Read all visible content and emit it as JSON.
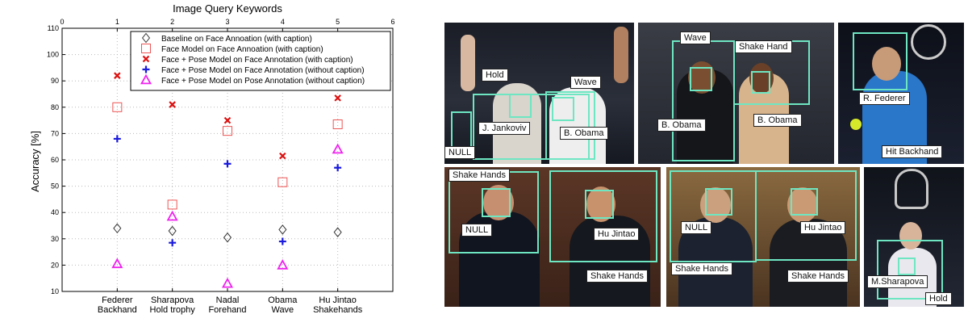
{
  "chart_data": {
    "type": "scatter",
    "title": "Image Query Keywords",
    "ylabel": "Accuracy [%]",
    "xlim": [
      0,
      6
    ],
    "ylim": [
      10,
      110
    ],
    "x_ticks_top": [
      "0",
      "1",
      "2",
      "3",
      "4",
      "5",
      "6"
    ],
    "y_ticks": [
      "10",
      "20",
      "30",
      "40",
      "50",
      "60",
      "70",
      "80",
      "90",
      "100",
      "110"
    ],
    "categories": [
      [
        "Federer",
        "Backhand"
      ],
      [
        "Sharapova",
        "Hold trophy"
      ],
      [
        "Nadal",
        "Forehand"
      ],
      [
        "Obama",
        "Wave"
      ],
      [
        "Hu Jintao",
        "Shakehands"
      ]
    ],
    "x": [
      1,
      2,
      3,
      4,
      5
    ],
    "grid": true,
    "legend_position": "top-right",
    "series": [
      {
        "name": "Baseline on Face Annoation (with caption)",
        "marker": "diamond",
        "color": "#333333",
        "values": [
          34,
          33,
          30.5,
          33.5,
          32.5
        ]
      },
      {
        "name": "Face Model on Face Annoation (with caption)",
        "marker": "square",
        "color": "#ee5555",
        "values": [
          80,
          43,
          null,
          51.5,
          73.5
        ]
      },
      {
        "name": "Face + Pose Model on Face Annotation (with caption)",
        "marker": "x",
        "color": "#dd1111",
        "values": [
          92,
          81,
          75,
          61.5,
          83.5
        ]
      },
      {
        "name": "Face + Pose Model on Face Annotation (without caption)",
        "marker": "plus",
        "color": "#1a1add",
        "values": [
          68,
          28.5,
          58.5,
          29,
          57
        ]
      },
      {
        "name": "Face + Pose Model on Pose Annotation (without caption)",
        "marker": "triangle",
        "color": "#ee22ee",
        "values": [
          20.5,
          38.5,
          13,
          20,
          64
        ]
      }
    ],
    "extra_points": [
      {
        "series": 1,
        "x": 3,
        "value": 71
      }
    ]
  },
  "photos": [
    {
      "id": "biden-obama",
      "tags": [
        "Hold",
        "Wave",
        "J. Jankoviv",
        "B. Obama",
        "NULL"
      ]
    },
    {
      "id": "obama-couple",
      "tags": [
        "Wave",
        "Shake Hand",
        "B. Obama",
        "B. Obama"
      ]
    },
    {
      "id": "federer",
      "tags": [
        "R. Federer",
        "Hit Backhand"
      ]
    },
    {
      "id": "hu-navy",
      "tags": [
        "Shake Hands",
        "NULL",
        "Hu Jintao",
        "Shake Hands"
      ]
    },
    {
      "id": "hu-suit",
      "tags": [
        "NULL",
        "Hu Jintao",
        "Shake Hands",
        "Shake Hands"
      ]
    },
    {
      "id": "sharapova",
      "tags": [
        "M.Sharapova",
        "Hold"
      ]
    }
  ],
  "colors": {
    "box": "#6ee6c2",
    "axis": "#000000",
    "grid": "#bbbbbb"
  }
}
